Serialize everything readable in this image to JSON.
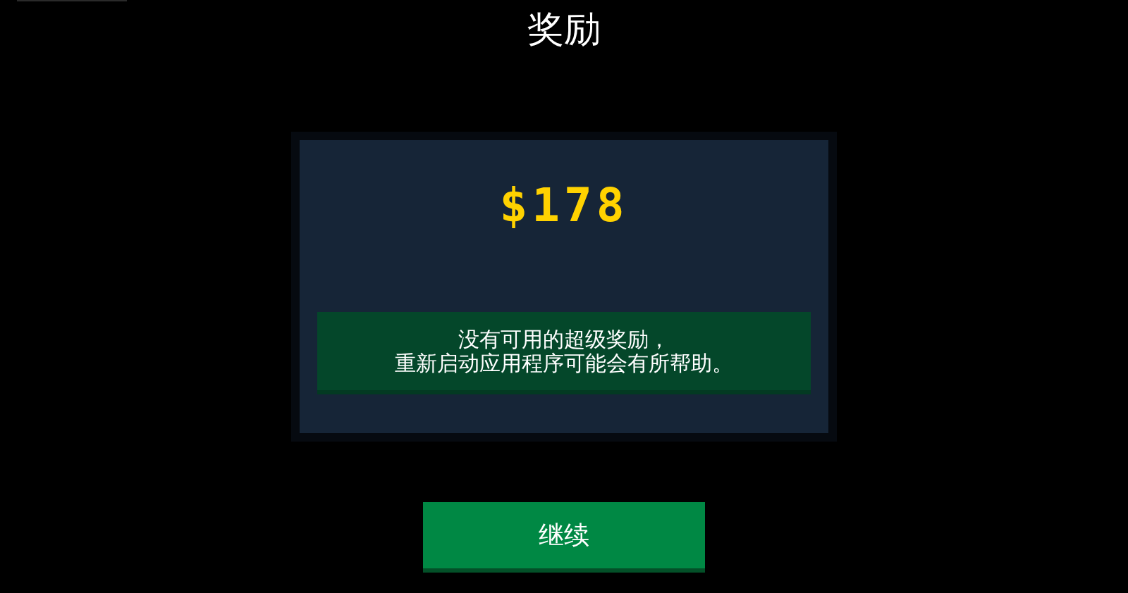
{
  "title": "奖励",
  "reward": {
    "amount": "$178",
    "message_lines": [
      "没有可用的超级奖励，",
      "重新启动应用程序可能会有所帮助。"
    ]
  },
  "continue_button": {
    "label": "继续"
  }
}
